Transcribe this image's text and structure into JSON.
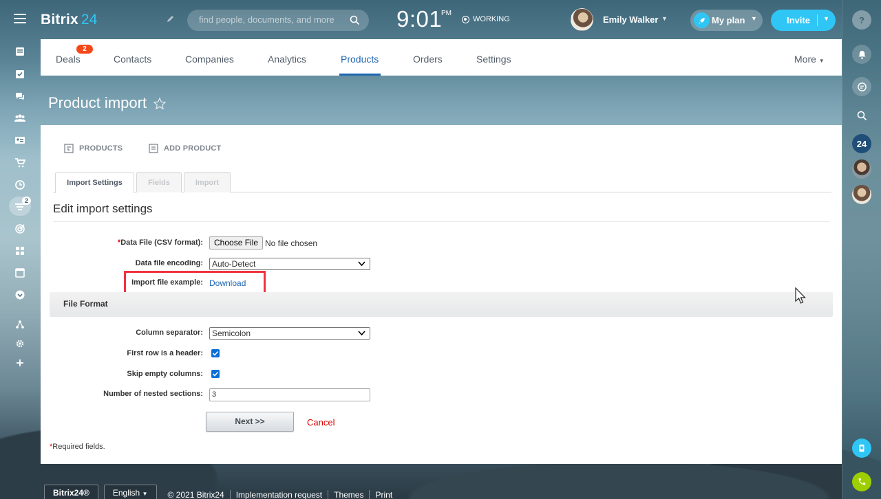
{
  "header": {
    "logo_main": "Bitrix",
    "logo_num": "24",
    "search_placeholder": "find people, documents, and more",
    "time": "9:01",
    "ampm": "PM",
    "status": "WORKING",
    "user_name": "Emily Walker",
    "myplan_label": "My plan",
    "invite_label": "Invite"
  },
  "left_bar": {
    "icons": [
      "feed-icon",
      "tasks-icon",
      "chat-icon",
      "employees-icon",
      "contact-card-icon",
      "cart-icon",
      "clock-icon",
      "crm-funnel-icon",
      "target-icon",
      "apps-grid-icon",
      "window-icon",
      "chevron-down-circle-icon",
      "sitemap-icon",
      "gear-icon",
      "plus-icon"
    ],
    "badge": "2"
  },
  "topnav": {
    "tabs": [
      "Deals",
      "Contacts",
      "Companies",
      "Analytics",
      "Products",
      "Orders",
      "Settings"
    ],
    "active_tab": "Products",
    "deals_badge": "2",
    "more": "More"
  },
  "page": {
    "title": "Product import"
  },
  "actions": {
    "products": "PRODUCTS",
    "add_product": "ADD PRODUCT"
  },
  "import_tabs": [
    "Import Settings",
    "Fields",
    "Import"
  ],
  "form": {
    "section_title": "Edit import settings",
    "data_file_label": "Data File (CSV format):",
    "required_mark": "*",
    "choose_file": "Choose File",
    "no_file": "No file chosen",
    "encoding_label": "Data file encoding:",
    "encoding_value": "Auto-Detect",
    "example_label": "Import file example:",
    "download": "Download",
    "file_format_title": "File Format",
    "separator_label": "Column separator:",
    "separator_value": "Semicolon",
    "header_label": "First row is a header:",
    "header_checked": true,
    "skip_label": "Skip empty columns:",
    "skip_checked": true,
    "nested_label": "Number of nested sections:",
    "nested_value": "3",
    "next_button": "Next >>",
    "cancel": "Cancel",
    "required_note": "Required fields."
  },
  "right_bar": {
    "help": "?",
    "num24": "24"
  },
  "footer": {
    "logo": "Bitrix24®",
    "language": "English",
    "copyright": "© 2021 Bitrix24",
    "links": [
      "Implementation request",
      "Themes",
      "Print"
    ]
  },
  "colors": {
    "accent": "#2067b0",
    "brand_blue": "#2fc6f6",
    "highlight_red": "#ef3340",
    "badge_orange": "#f54819"
  }
}
